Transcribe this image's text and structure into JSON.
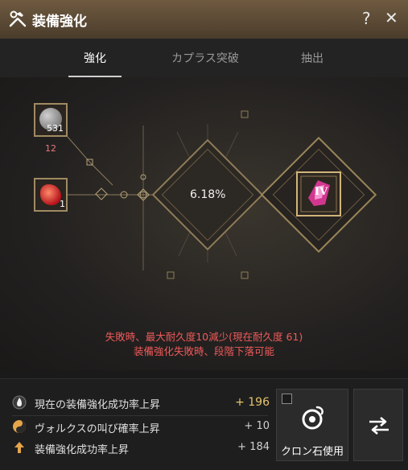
{
  "header": {
    "title": "装備強化",
    "help_label": "?",
    "close_label": "✕",
    "accent": "#6f5a40"
  },
  "tabs": [
    {
      "label": "強化",
      "active": true
    },
    {
      "label": "カプラス突破",
      "active": false
    },
    {
      "label": "抽出",
      "active": false
    }
  ],
  "materials": {
    "black_stone": {
      "count": "531",
      "required": "12",
      "icon": "gray-stone-icon"
    },
    "crystal": {
      "count": "1",
      "icon": "red-crystal-icon"
    }
  },
  "enhance": {
    "success_rate": "6.18%",
    "target_grade": "IV",
    "target_icon": "pink-gem-icon"
  },
  "warnings": [
    "失敗時、最大耐久度10減少(現在耐久度 61)",
    "装備強化失敗時、段階下落可能"
  ],
  "bonuses": {
    "total": {
      "label": "現在の装備強化成功率上昇",
      "value": "+ 196",
      "icon": "flame-icon"
    },
    "items": [
      {
        "label": "ヴォルクスの叫び確率上昇",
        "value": "+ 10",
        "icon": "yin-yang-icon"
      },
      {
        "label": "装備強化成功率上昇",
        "value": "+ 184",
        "icon": "up-arrow-icon"
      }
    ]
  },
  "buttons": {
    "cron_label": "クロン石使用",
    "cron_checked": false,
    "swap_icon": "swap-arrows-icon"
  },
  "colors": {
    "warning": "#ee5a5a",
    "bonus_total": "#e8c56d",
    "material_count": "#e8787a",
    "frame_gold": "#a08a62"
  }
}
